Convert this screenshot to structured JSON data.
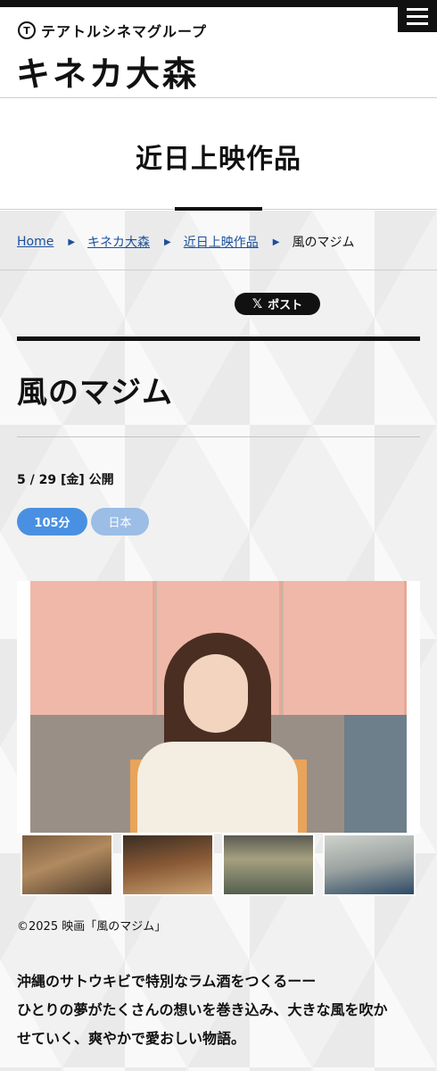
{
  "header": {
    "logo_letter": "T",
    "group_name": "テアトルシネマグループ",
    "theater_name": "キネカ大森",
    "menu_icon": "hamburger-menu-icon"
  },
  "page": {
    "heading": "近日上映作品"
  },
  "breadcrumb": {
    "items": [
      "Home",
      "キネカ大森",
      "近日上映作品"
    ],
    "current": "風のマジム",
    "separator": "▶"
  },
  "share": {
    "post_label": "ポスト",
    "x_glyph": "𝕏"
  },
  "movie": {
    "title": "風のマジム",
    "release": "5 / 29 [金] 公開",
    "runtime": "105分",
    "country": "日本",
    "credit": "©2025 映画「風のマジム」",
    "synopsis_lines": [
      "沖縄のサトウキビで特別なラム酒をつくるーー",
      "ひとりの夢がたくさんの想いを巻き込み、大きな風を吹か",
      "せていく、爽やかで愛おしい物語。"
    ]
  },
  "colors": {
    "accent_blue": "#4a90e2",
    "tag_light_blue": "#9bbde6",
    "link_blue": "#1a4f9c",
    "dark": "#111111"
  }
}
